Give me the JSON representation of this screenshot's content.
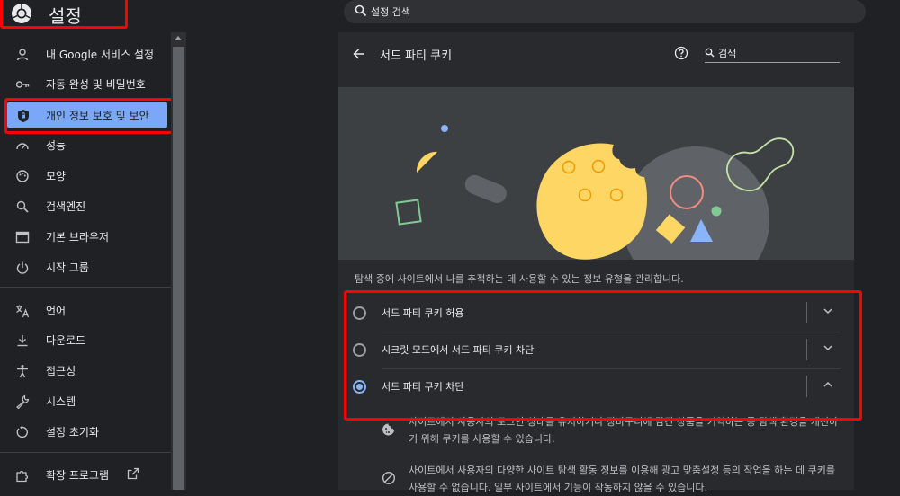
{
  "app": {
    "title": "설정"
  },
  "search": {
    "placeholder": "설정 검색"
  },
  "sidebar": {
    "items": [
      {
        "label": "내 Google 서비스 설정",
        "icon": "person-icon"
      },
      {
        "label": "자동 완성 및 비밀번호",
        "icon": "key-icon"
      },
      {
        "label": "개인 정보 보호 및 보안",
        "icon": "shield-icon",
        "active": true
      },
      {
        "label": "성능",
        "icon": "speedometer-icon"
      },
      {
        "label": "모양",
        "icon": "palette-icon"
      },
      {
        "label": "검색엔진",
        "icon": "search-icon"
      },
      {
        "label": "기본 브라우저",
        "icon": "browser-window-icon"
      },
      {
        "label": "시작 그룹",
        "icon": "power-icon"
      },
      {
        "label": "언어",
        "icon": "translate-icon"
      },
      {
        "label": "다운로드",
        "icon": "download-icon"
      },
      {
        "label": "접근성",
        "icon": "accessibility-icon"
      },
      {
        "label": "시스템",
        "icon": "wrench-icon"
      },
      {
        "label": "설정 초기화",
        "icon": "reset-icon"
      },
      {
        "label": "확장 프로그램",
        "icon": "puzzle-icon"
      }
    ]
  },
  "page": {
    "title": "서드 파티 쿠키",
    "search_label": "검색",
    "description": "탐색 중에 사이트에서 나를 추적하는 데 사용할 수 있는 정보 유형을 관리합니다.",
    "options": [
      {
        "label": "서드 파티 쿠키 허용",
        "selected": false,
        "expanded": false
      },
      {
        "label": "시크릿 모드에서 서드 파티 쿠키 차단",
        "selected": false,
        "expanded": false
      },
      {
        "label": "서드 파티 쿠키 차단",
        "selected": true,
        "expanded": true
      }
    ],
    "details": [
      {
        "icon": "cookie-icon",
        "text": "사이트에서 사용자의 로그인 상태를 유지하거나 장바구니에 담긴 상품을 기억하는 등 탐색 환경을 개선하기 위해 쿠키를 사용할 수 있습니다."
      },
      {
        "icon": "block-icon",
        "text": "사이트에서 사용자의 다양한 사이트 탐색 활동 정보를 이용해 광고 맞춤설정 등의 작업을 하는 데 쿠키를 사용할 수 없습니다. 일부 사이트에서 기능이 작동하지 않을 수 있습니다."
      }
    ]
  },
  "colors": {
    "accent": "#8ab4f8",
    "highlight": "#ff0000",
    "active_item": "#7aa7f7",
    "cookie": "#fdd663"
  }
}
